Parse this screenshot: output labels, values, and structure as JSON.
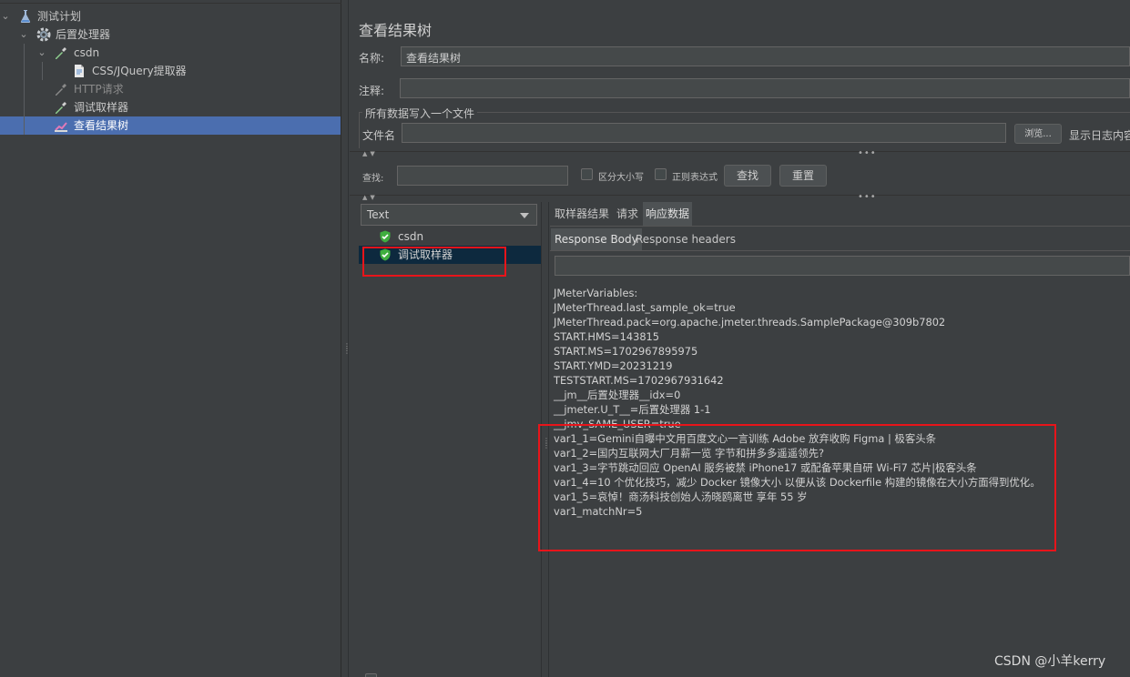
{
  "tree": {
    "items": [
      {
        "label": "测试计划",
        "icon": "flask-icon"
      },
      {
        "label": "后置处理器",
        "icon": "gear-icon"
      },
      {
        "label": "csdn",
        "icon": "pipette-icon"
      },
      {
        "label": "CSS/JQuery提取器",
        "icon": "document-icon"
      },
      {
        "label": "HTTP请求",
        "icon": "pipette-icon",
        "disabled": true
      },
      {
        "label": "调试取样器",
        "icon": "pipette-icon"
      },
      {
        "label": "查看结果树",
        "icon": "chart-icon",
        "selected": true
      }
    ]
  },
  "panel": {
    "title": "查看结果树",
    "name_label": "名称:",
    "name_value": "查看结果树",
    "comment_label": "注释:",
    "file_group_title": "所有数据写入一个文件",
    "filename_label": "文件名",
    "browse_label": "浏览...",
    "log_label": "显示日志内容",
    "search_label": "查找:",
    "case_label": "区分大小写",
    "regex_label": "正则表达式",
    "find_button": "查找",
    "reset_button": "重置"
  },
  "results": {
    "renderer": "Text",
    "items": [
      {
        "label": "csdn",
        "status": "success"
      },
      {
        "label": "调试取样器",
        "status": "success",
        "selected": true
      }
    ]
  },
  "tabs": {
    "main": [
      "取样器结果",
      "请求",
      "响应数据"
    ],
    "active_main": "响应数据",
    "sub": [
      "Response Body",
      "Response headers"
    ],
    "active_sub": "Response Body"
  },
  "response_lines": [
    "JMeterVariables:",
    "JMeterThread.last_sample_ok=true",
    "JMeterThread.pack=org.apache.jmeter.threads.SamplePackage@309b7802",
    "START.HMS=143815",
    "START.MS=1702967895975",
    "START.YMD=20231219",
    "TESTSTART.MS=1702967931642",
    "__jm__后置处理器__idx=0",
    "__jmeter.U_T__=后置处理器 1-1",
    "__jmv_SAME_USER=true",
    "var1_1=Gemini自曝中文用百度文心一言训练 Adobe 放弃收购 Figma | 极客头条",
    "var1_2=国内互联网大厂月薪一览 字节和拼多多遥遥领先?",
    "var1_3=字节跳动回应 OpenAI 服务被禁 iPhone17 或配备苹果自研 Wi-Fi7 芯片|极客头条",
    "var1_4=10 个优化技巧，减少 Docker 镜像大小 以便从该 Dockerfile 构建的镜像在大小方面得到优化。",
    "var1_5=哀悼！商汤科技创始人汤晓鸥离世 享年 55 岁",
    "var1_matchNr=5"
  ],
  "watermark": "CSDN @小羊kerry",
  "colors": {
    "background": "#3c3f41",
    "selection": "#4b6eaf",
    "highlight_box": "#e8141a",
    "success_green": "#3fae3f"
  }
}
